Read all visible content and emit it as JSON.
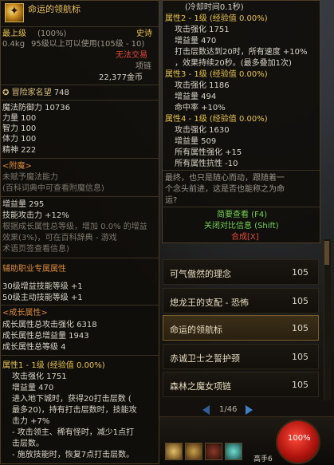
{
  "left_tooltip": {
    "item_name": "命运的领航标",
    "grade": "最上级",
    "grade_percent": "(100%)",
    "rarity": "史诗",
    "weight": "0.4kg",
    "level_requirement": "95级以上可以使用(105级 - 10)",
    "trade_status": "无法交易",
    "slot": "项链",
    "price": "22,377金币",
    "adventurer_fame_label": "冒险家名望",
    "adventurer_fame_value": "748",
    "stats": [
      "魔法防御力 10736",
      "力量 100",
      "智力 100",
      "体力 100",
      "精神 222"
    ],
    "enchant_header": "<附魔>",
    "enchant_lines": [
      "未赋予魔法能力",
      "(百科词典中可查看附魔信息)"
    ],
    "growth_stats": [
      "增益量 295",
      "技能攻击力 +12%",
      "根据成长属性总等级，增加 0.0% 的增益",
      "效果(3%)，可在百科辞典 - 游戏",
      "术语页签查看信息)"
    ],
    "support_header": "辅助职业专属属性",
    "support_lines": [
      "30级增益技能等级 +1",
      "50级主动技能等级 +1"
    ],
    "growth_header": "<成长属性>",
    "growth_lines": [
      "成长属性总攻击强化 6318",
      "成长属性总增益量 1943",
      "成长属性总等级 4"
    ],
    "attr1_title": "属性1 - 1级 (经验值 0.00%)",
    "attr1_lines": [
      "攻击强化 1751",
      "增益量 470",
      "进入地下城时，获得20打击层数 (",
      "最多20)，持有打击层数时，技能攻",
      "击力 +7%",
      "- 攻击领主、稀有怪时，减少1点打",
      "击层数。",
      "- 施放技能时，恢复7点打击层数。"
    ]
  },
  "right_tooltip": {
    "top_lines": [
      "(冷却时间0.1秒)",
      "属性2 - 1级 (经验值 0.00%)",
      "攻击强化 1751",
      "增益量 470",
      "打击层数达到20时，所有速度 +10%",
      "，效果持续20秒。(最多叠加1次)",
      "属性3 - 1级 (经验值 0.00%)",
      "攻击强化 1186",
      "增益量 494",
      "命中率 +10%",
      "属性4 - 1级 (经验值 0.00%)",
      "攻击强化 1630",
      "增益量 509",
      "所有属性强化 +15",
      "所有属性抗性 -10"
    ],
    "flavor_text": [
      "最终，也只是随心而动，跟随着一",
      "个念头前进，这是否也能称之为命",
      "运?"
    ],
    "simple_view": "简要查看 (F4)",
    "close_compare": "关闭对比信息 (Shift)",
    "compose": "合成[X]"
  },
  "item_list": [
    {
      "name": "可气傲然的理念",
      "level": "105",
      "selected": false
    },
    {
      "name": "熄龙王的支配 - 恐怖",
      "level": "105",
      "selected": false
    },
    {
      "name": "命运的领航标",
      "level": "105",
      "selected": true
    },
    {
      "name": "赤诚卫士之誓护颈",
      "level": "105",
      "selected": false
    },
    {
      "name": "森林之魔女项链",
      "level": "105",
      "selected": false
    }
  ],
  "pager": {
    "text": "1/46"
  },
  "hud": {
    "hp_percent": "100%",
    "label": "高手6"
  }
}
